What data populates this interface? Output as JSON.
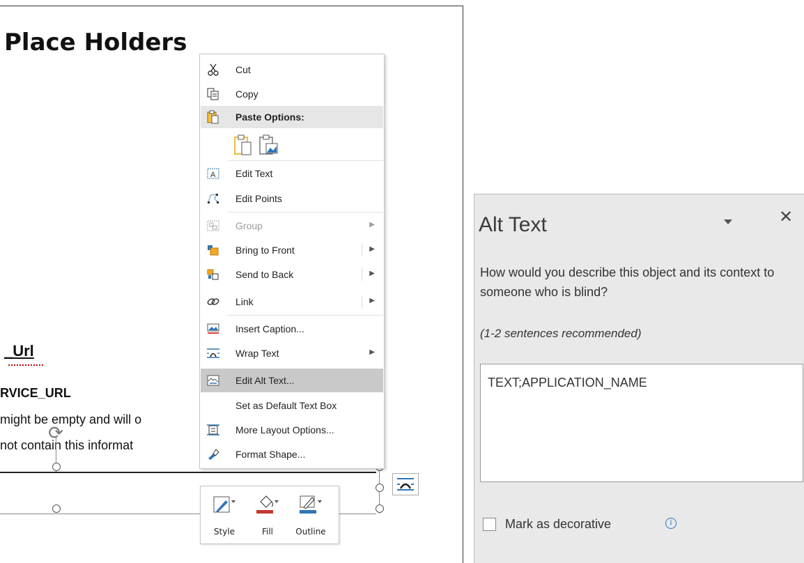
{
  "document": {
    "heading": "Place Holders",
    "url_heading": "_Url",
    "service_url": "RVICE_URL",
    "body_line1": "might be empty and will o",
    "body_line2": "not contain this informat"
  },
  "context_menu": {
    "items": [
      {
        "label": "Cut",
        "icon": "scissors-icon"
      },
      {
        "label": "Copy",
        "icon": "copy-icon"
      },
      {
        "label": "Paste Options:",
        "icon": "paste-icon"
      },
      {
        "label": "Edit Text",
        "icon": "edit-text-icon"
      },
      {
        "label": "Edit Points",
        "icon": "edit-points-icon"
      },
      {
        "label": "Group",
        "icon": "group-icon",
        "disabled": true,
        "submenu": true
      },
      {
        "label": "Bring to Front",
        "icon": "bring-to-front-icon",
        "submenu": true
      },
      {
        "label": "Send to Back",
        "icon": "send-to-back-icon",
        "submenu": true
      },
      {
        "label": "Link",
        "icon": "link-icon",
        "submenu": true
      },
      {
        "label": "Insert Caption...",
        "icon": "insert-caption-icon"
      },
      {
        "label": "Wrap Text",
        "icon": "wrap-text-icon",
        "submenu": true
      },
      {
        "label": "Edit Alt Text...",
        "icon": "alt-text-icon",
        "highlighted": true
      },
      {
        "label": "Set as Default Text Box"
      },
      {
        "label": "More Layout Options...",
        "icon": "layout-options-icon"
      },
      {
        "label": "Format Shape...",
        "icon": "format-shape-icon"
      }
    ]
  },
  "mini_toolbar": {
    "style_label": "Style",
    "fill_label": "Fill",
    "outline_label": "Outline",
    "fill_color": "#c0392b",
    "outline_color": "#2e75b6"
  },
  "alt_text_pane": {
    "title": "Alt Text",
    "question": "How would you describe this object and its context to someone who is blind?",
    "hint": "(1-2 sentences recommended)",
    "value": "TEXT;APPLICATION_NAME",
    "decorative_label": "Mark as decorative"
  }
}
